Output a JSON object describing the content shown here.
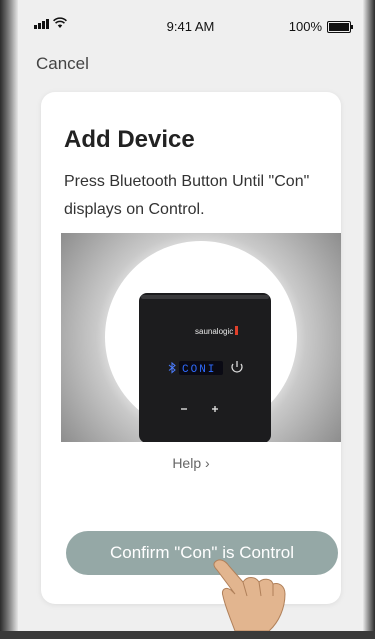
{
  "status_bar": {
    "time": "9:41 AM",
    "battery_text": "100%",
    "battery_level": 1.0
  },
  "nav": {
    "cancel_label": "Cancel"
  },
  "card": {
    "title": "Add Device",
    "instruction": "Press Bluetooth Button Until \"Con\" displays on Control.",
    "help_label": "Help ›",
    "confirm_label": "Confirm \"Con\" is Control"
  },
  "device": {
    "brand_text": "saunalogic",
    "display_text": "CONI"
  },
  "colors": {
    "screen_bg": "#efefef",
    "card_bg": "#ffffff",
    "confirm_button": "#95a8a6",
    "display_led": "#2f6bff",
    "brand_accent": "#e0402b"
  },
  "icons": [
    "signal-icon",
    "wifi-icon",
    "battery-icon",
    "bluetooth-icon",
    "power-icon",
    "minus-icon",
    "plus-icon",
    "hand-pointer"
  ]
}
